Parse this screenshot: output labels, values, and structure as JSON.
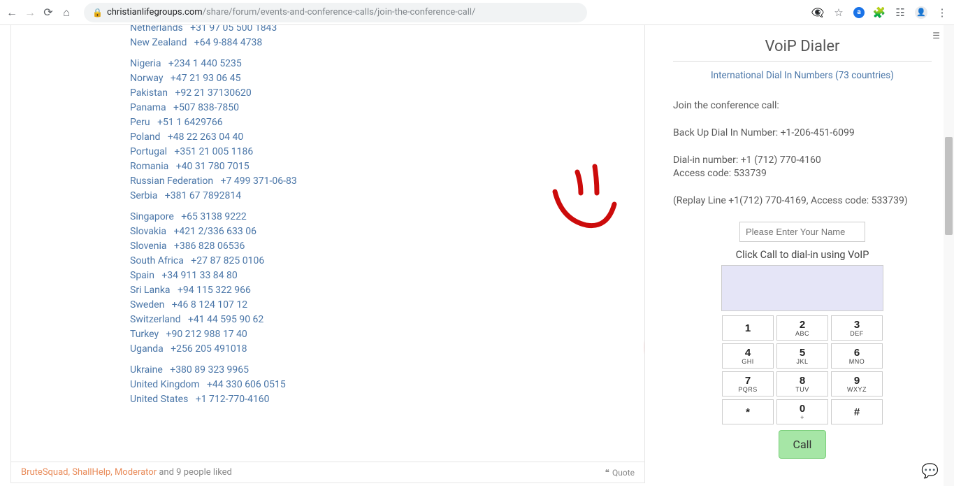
{
  "browser": {
    "url_host": "christianlifegroups.com",
    "url_path": "/share/forum/events-and-conference-calls/join-the-conference-call/"
  },
  "dial_list": {
    "group1": [
      {
        "c": "Netherlands",
        "n": "+31 97 05 500 1843"
      },
      {
        "c": "New Zealand",
        "n": "+64 9-884 4738"
      }
    ],
    "group2": [
      {
        "c": "Nigeria",
        "n": "+234 1 440 5235"
      },
      {
        "c": "Norway",
        "n": "+47 21 93 06 45"
      },
      {
        "c": "Pakistan",
        "n": "+92 21 37130620"
      },
      {
        "c": "Panama",
        "n": "+507 838-7850"
      },
      {
        "c": "Peru",
        "n": "+51 1 6429766"
      },
      {
        "c": "Poland",
        "n": "+48 22 263 04 40"
      },
      {
        "c": "Portugal",
        "n": "+351 21 005 1186"
      },
      {
        "c": "Romania",
        "n": "+40 31 780 7015"
      },
      {
        "c": "Russian Federation",
        "n": "+7 499 371-06-83"
      },
      {
        "c": "Serbia",
        "n": "+381 67 7892814"
      }
    ],
    "group3": [
      {
        "c": "Singapore",
        "n": "+65 3138 9222"
      },
      {
        "c": "Slovakia",
        "n": "+421 2/336 633 06"
      },
      {
        "c": "Slovenia",
        "n": "+386 828 06536"
      },
      {
        "c": "South Africa",
        "n": "+27 87 825 0106"
      },
      {
        "c": "Spain",
        "n": "+34 911 33 84 80"
      },
      {
        "c": "Sri Lanka",
        "n": "+94 115 322 966"
      },
      {
        "c": "Sweden",
        "n": "+46 8 124 107 12"
      },
      {
        "c": "Switzerland",
        "n": "+41 44 595 90 62"
      },
      {
        "c": "Turkey",
        "n": "+90 212 988 17 40"
      },
      {
        "c": "Uganda",
        "n": "+256 205 491018"
      }
    ],
    "group4": [
      {
        "c": "Ukraine",
        "n": "+380 89 323 9965"
      },
      {
        "c": "United Kingdom",
        "n": "+44 330 606 0515"
      },
      {
        "c": "United States",
        "n": "+1 712-770-4160"
      }
    ]
  },
  "post_footer": {
    "names": "BruteSquad, ShallHelp, Moderator",
    "rest": " and 9 people liked",
    "quote": "Quote"
  },
  "sidebar": {
    "title": "VoiP Dialer",
    "intl_link": "International Dial In Numbers (73 countries)",
    "join_line": "Join the conference call:",
    "backup_line": "Back Up Dial In Number:  +1-206-451-6099",
    "dialin_line": "Dial-in number: +1 (712) 770-4160",
    "access_line": "Access code: 533739",
    "replay_line": "(Replay Line +1(712) 770-4169, Access code: 533739)",
    "name_placeholder": "Please Enter Your Name",
    "subtitle": "Click Call to dial-in using VoIP",
    "call": "Call"
  },
  "keypad": [
    {
      "num": "1",
      "let": ""
    },
    {
      "num": "2",
      "let": "ABC"
    },
    {
      "num": "3",
      "let": "DEF"
    },
    {
      "num": "4",
      "let": "GHI"
    },
    {
      "num": "5",
      "let": "JKL"
    },
    {
      "num": "6",
      "let": "MNO"
    },
    {
      "num": "7",
      "let": "PQRS"
    },
    {
      "num": "8",
      "let": "TUV"
    },
    {
      "num": "9",
      "let": "WXYZ"
    },
    {
      "num": "*",
      "let": ""
    },
    {
      "num": "0",
      "let": "+"
    },
    {
      "num": "#",
      "let": ""
    }
  ]
}
